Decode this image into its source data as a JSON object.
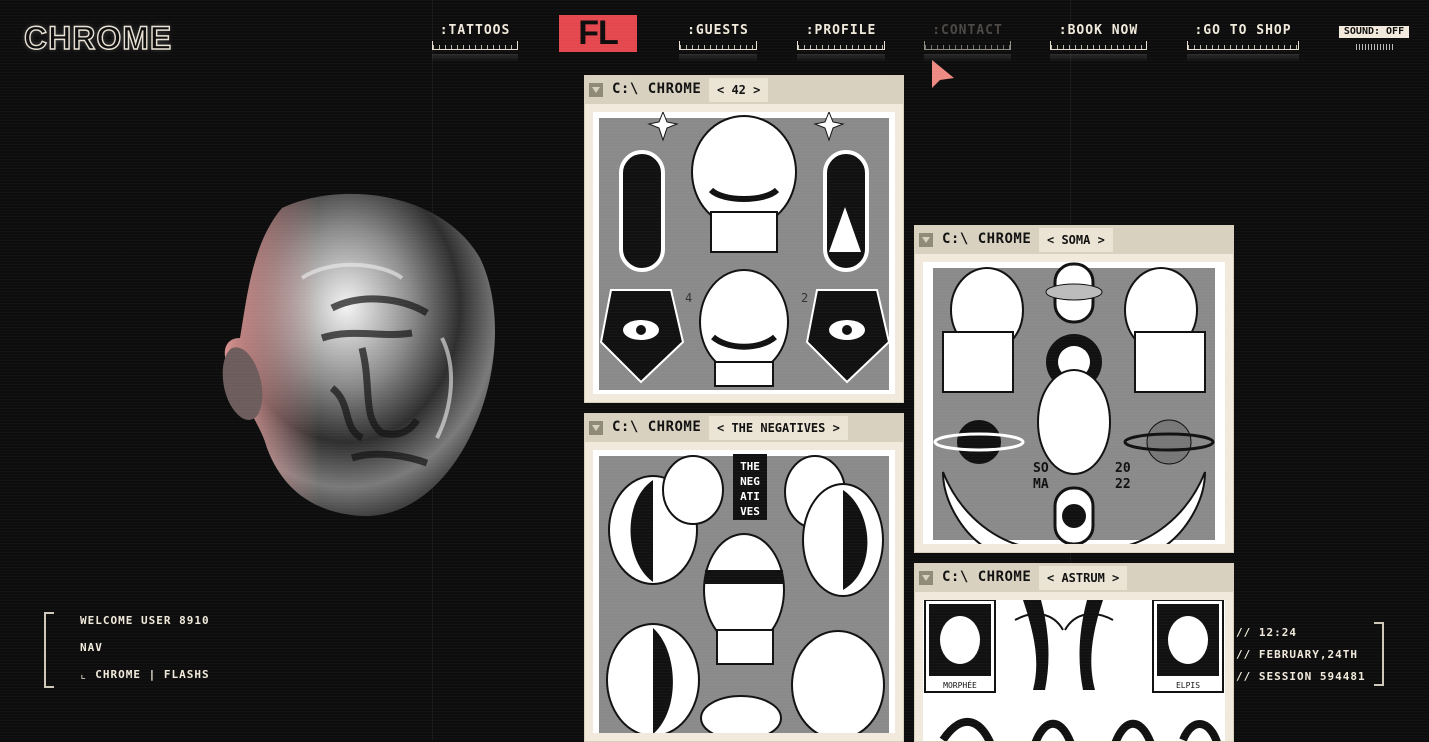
{
  "brand": {
    "logo": "CHROME",
    "fl_logo": "FL"
  },
  "nav": {
    "tattoos": ":TATTOOS",
    "guests": ":GUESTS",
    "profile": ":PROFILE",
    "contact": ":CONTACT",
    "book_now": ":BOOK NOW",
    "shop": ":GO TO SHOP",
    "sound": "SOUND: OFF"
  },
  "windows": [
    {
      "path": "C:\\ CHROME",
      "tag": "< 42 >"
    },
    {
      "path": "C:\\ CHROME",
      "tag": "< THE NEGATIVES >"
    },
    {
      "path": "C:\\ CHROME",
      "tag": "< SOMA >"
    },
    {
      "path": "C:\\ CHROME",
      "tag": "< ASTRUM >"
    }
  ],
  "artwork": {
    "negatives_block": [
      "THE",
      "NEG",
      "ATI",
      "VES"
    ],
    "soma_left": [
      "SO",
      "MA"
    ],
    "soma_right": [
      "20",
      "22"
    ],
    "numbers": [
      "4",
      "2"
    ],
    "morphee": "MORPHÉE",
    "elpis": "ELPIS"
  },
  "panel": {
    "welcome": "WELCOME USER 8910",
    "nav": "NAV",
    "crumb": "⌞ CHROME | FLASHS"
  },
  "info": {
    "time": "// 12:24",
    "date": "// FEBRUARY,24TH",
    "session": "// SESSION 594481"
  },
  "colors": {
    "accent": "#e4484e",
    "window": "#f1eadc",
    "titlebar": "#d9d1bf",
    "background": "#0d0d0d"
  }
}
